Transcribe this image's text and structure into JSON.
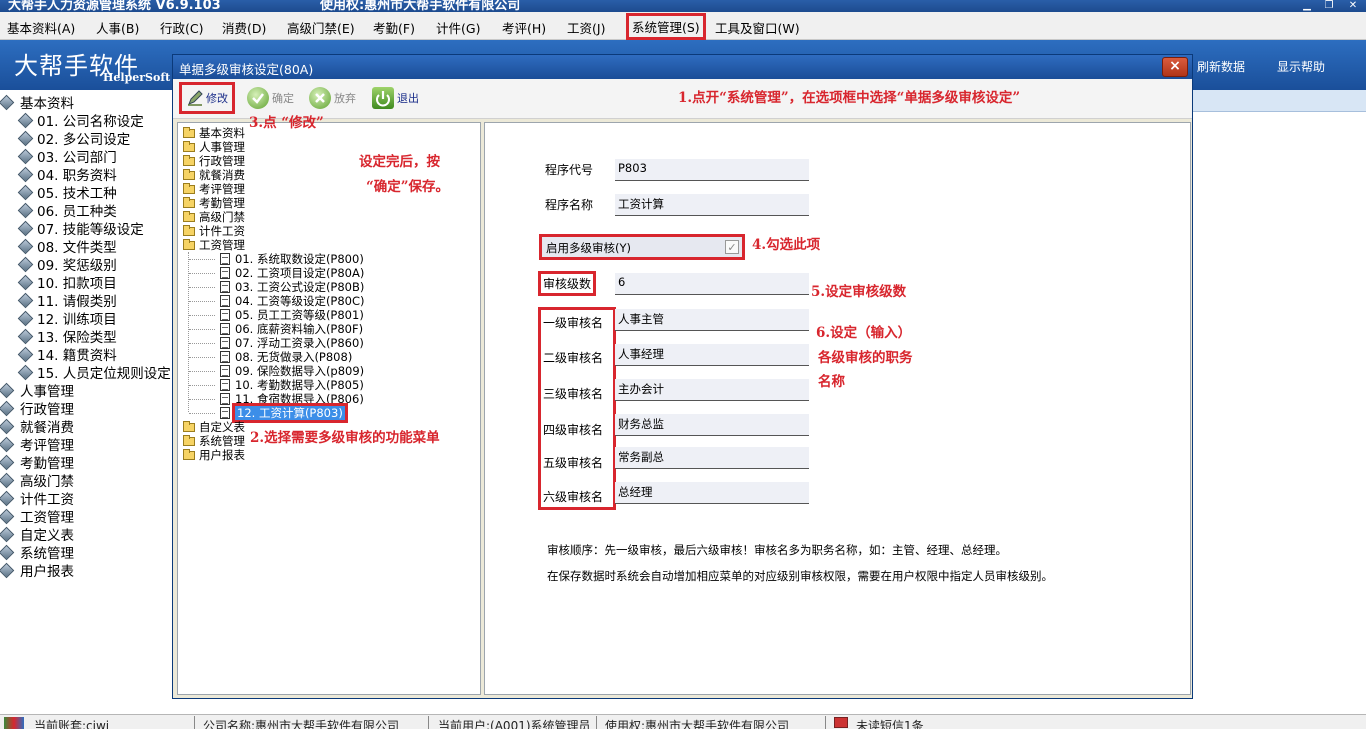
{
  "window": {
    "app_title": "大帮手人力资源管理系统 V6.9.103",
    "license_title": "使用权:惠州市大帮手软件有限公司"
  },
  "menu": [
    "基本资料(A)",
    "人事(B)",
    "行政(C)",
    "消费(D)",
    "高级门禁(E)",
    "考勤(F)",
    "计件(G)",
    "考评(H)",
    "工资(J)",
    "系统管理(S)",
    "工具及窗口(W)"
  ],
  "banner": {
    "logo": "大帮手软件",
    "logo_sub": "HelperSoft",
    "refresh": "刷新数据",
    "help": "显示帮助"
  },
  "sidebar": {
    "group": "基本资料",
    "items": [
      "01. 公司名称设定",
      "02. 多公司设定",
      "03. 公司部门",
      "04. 职务资料",
      "05. 技术工种",
      "06. 员工种类",
      "07. 技能等级设定",
      "08. 文件类型",
      "09. 奖惩级别",
      "10. 扣款项目",
      "11. 请假类别",
      "12. 训练项目",
      "13. 保险类型",
      "14. 籍贯资料",
      "15. 人员定位规则设定"
    ],
    "modules": [
      "人事管理",
      "行政管理",
      "就餐消费",
      "考评管理",
      "考勤管理",
      "高级门禁",
      "计件工资",
      "工资管理",
      "自定义表",
      "系统管理",
      "用户报表"
    ]
  },
  "dialog": {
    "title": "单据多级审核设定(80A)",
    "close": "×",
    "toolbar": {
      "edit": "修改",
      "confirm": "确定",
      "discard": "放弃",
      "exit": "退出"
    },
    "tree": {
      "groups_top": [
        "基本资料",
        "人事管理",
        "行政管理",
        "就餐消费",
        "考评管理",
        "考勤管理",
        "高级门禁",
        "计件工资",
        "工资管理"
      ],
      "salary_children": [
        "01. 系统取数设定(P800)",
        "02. 工资项目设定(P80A)",
        "03. 工资公式设定(P80B)",
        "04. 工资等级设定(P80C)",
        "05. 员工工资等级(P801)",
        "06. 底薪资料输入(P80F)",
        "07. 浮动工资录入(P860)",
        "08. 无货做录入(P808)",
        "09. 保险数据导入(p809)",
        "10. 考勤数据导入(P805)",
        "11. 食宿数据导入(P806)",
        "12. 工资计算(P803)"
      ],
      "groups_bottom": [
        "自定义表",
        "系统管理",
        "用户报表"
      ]
    },
    "form": {
      "program_code_label": "程序代号",
      "program_code": "P803",
      "program_name_label": "程序名称",
      "program_name": "工资计算",
      "enable_multi_review": "启用多级审核(Y)",
      "enable_checked": "✓",
      "review_levels_label": "审核级数",
      "review_levels": "6",
      "levels": [
        {
          "label": "一级审核名",
          "value": "人事主管"
        },
        {
          "label": "二级审核名",
          "value": "人事经理"
        },
        {
          "label": "三级审核名",
          "value": "主办会计"
        },
        {
          "label": "四级审核名",
          "value": "财务总监"
        },
        {
          "label": "五级审核名",
          "value": "常务副总"
        },
        {
          "label": "六级审核名",
          "value": "总经理"
        }
      ],
      "note1": "审核顺序：先一级审核，最后六级审核！审核名多为职务名称，如：主管、经理、总经理。",
      "note2": "在保存数据时系统会自动增加相应菜单的对应级别审核权限，需要在用户权限中指定人员审核级别。"
    }
  },
  "annotations": {
    "a1": "1.点开“系统管理”，在选项框中选择“单据多级审核设定”",
    "a2": "2.选择需要多级审核的功能菜单",
    "a3": "3.点 “修改”",
    "a4": "4.勾选此项",
    "a5": "5.设定审核级数",
    "a6_1": "6.设定（输入）",
    "a6_2": "各级审核的职务",
    "a6_3": "名称",
    "save_1": "设定完后，按",
    "save_2": "“确定”保存。"
  },
  "statusbar": {
    "account": "当前账套:ciwi",
    "company": "公司名称:惠州市大帮手软件有限公司",
    "user": "当前用户:(A001)系统管理员",
    "license": "使用权:惠州市大帮手软件有限公司",
    "sms": "未读短信1条"
  },
  "colors": {
    "annotation": "#d8262e",
    "titlebar": "#1d4b8f",
    "banner": "#2d6ec0",
    "highlight": "#3c8ee8"
  }
}
